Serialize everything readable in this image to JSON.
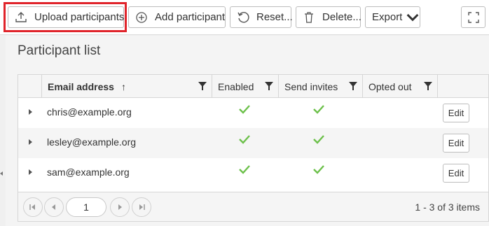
{
  "toolbar": {
    "upload_label": "Upload participants",
    "add_label": "Add participant",
    "reset_label": "Reset...",
    "delete_label": "Delete...",
    "export_label": "Export"
  },
  "panel": {
    "title": "Participant list"
  },
  "grid": {
    "columns": {
      "email": "Email address",
      "enabled": "Enabled",
      "send_invites": "Send invites",
      "opted_out": "Opted out"
    },
    "sort_indicator": "↑",
    "rows": [
      {
        "email": "chris@example.org",
        "enabled": true,
        "send_invites": true,
        "opted_out": false,
        "action": "Edit"
      },
      {
        "email": "lesley@example.org",
        "enabled": true,
        "send_invites": true,
        "opted_out": false,
        "action": "Edit"
      },
      {
        "email": "sam@example.org",
        "enabled": true,
        "send_invites": true,
        "opted_out": false,
        "action": "Edit"
      }
    ]
  },
  "pager": {
    "current_page": "1",
    "summary": "1 - 3 of 3 items"
  },
  "colors": {
    "check": "#6cc04a",
    "highlight": "#e0242b"
  },
  "icons": {
    "upload": "upload-icon",
    "add": "plus-circle-icon",
    "reset": "refresh-icon",
    "delete": "trash-icon",
    "export": "chevron-down-icon",
    "fullscreen": "fullscreen-icon",
    "filter": "filter-icon",
    "check": "check-icon"
  }
}
